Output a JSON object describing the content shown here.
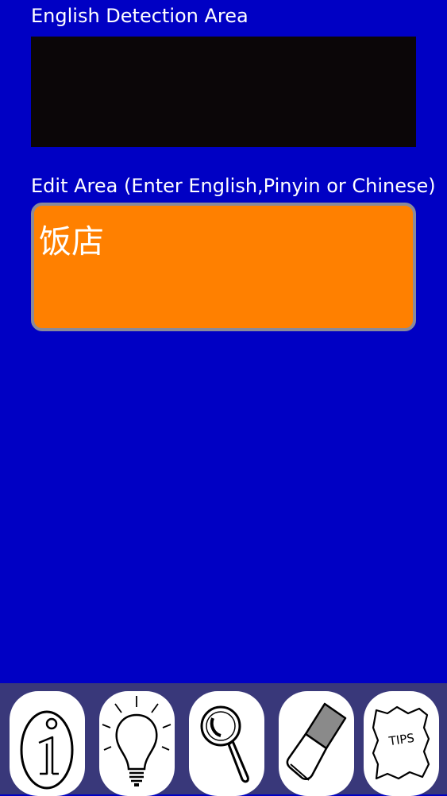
{
  "english_detection": {
    "label": "English Detection Area",
    "content": ""
  },
  "edit": {
    "label": "Edit Area (Enter English,Pinyin or Chinese)",
    "value": "饭店"
  },
  "toolbar": {
    "buttons": [
      {
        "icon": "info-icon"
      },
      {
        "icon": "lightbulb-icon"
      },
      {
        "icon": "magnifier-icon"
      },
      {
        "icon": "eraser-icon"
      },
      {
        "icon": "tips-note-icon",
        "text": "TIPS"
      }
    ]
  },
  "colors": {
    "background": "#0000c4",
    "edit_area": "#ff8000",
    "detection_area": "#0b0608",
    "toolbar": "#39387a"
  }
}
